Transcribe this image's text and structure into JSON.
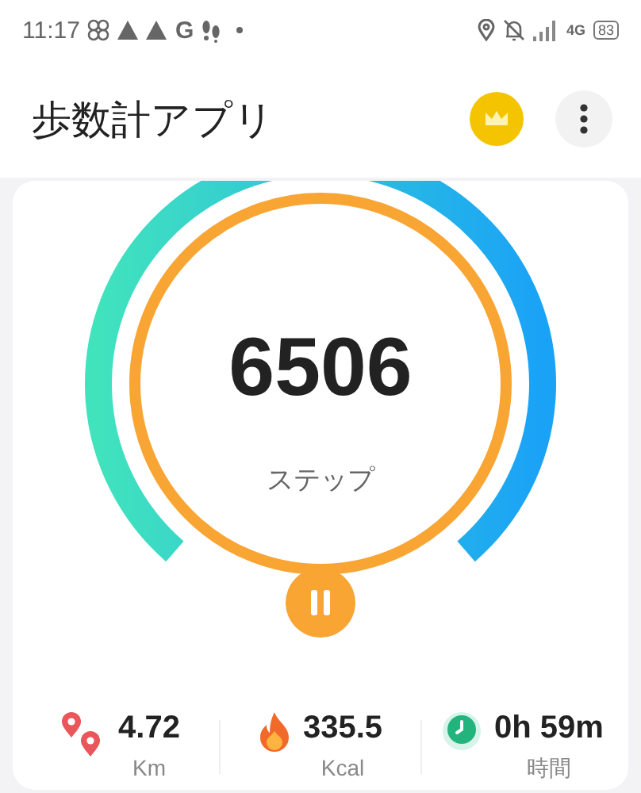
{
  "status_bar": {
    "time": "11:17",
    "notification_letter": "G",
    "network": "4G",
    "battery": "83"
  },
  "app_bar": {
    "title": "歩数計アプリ"
  },
  "gauge": {
    "steps": "6506",
    "unit": "ステップ"
  },
  "stats": [
    {
      "kind": "distance",
      "value": "4.72",
      "unit": "Km"
    },
    {
      "kind": "calories",
      "value": "335.5",
      "unit": "Kcal"
    },
    {
      "kind": "time",
      "value": "0h 59m",
      "unit": "時間"
    }
  ]
}
